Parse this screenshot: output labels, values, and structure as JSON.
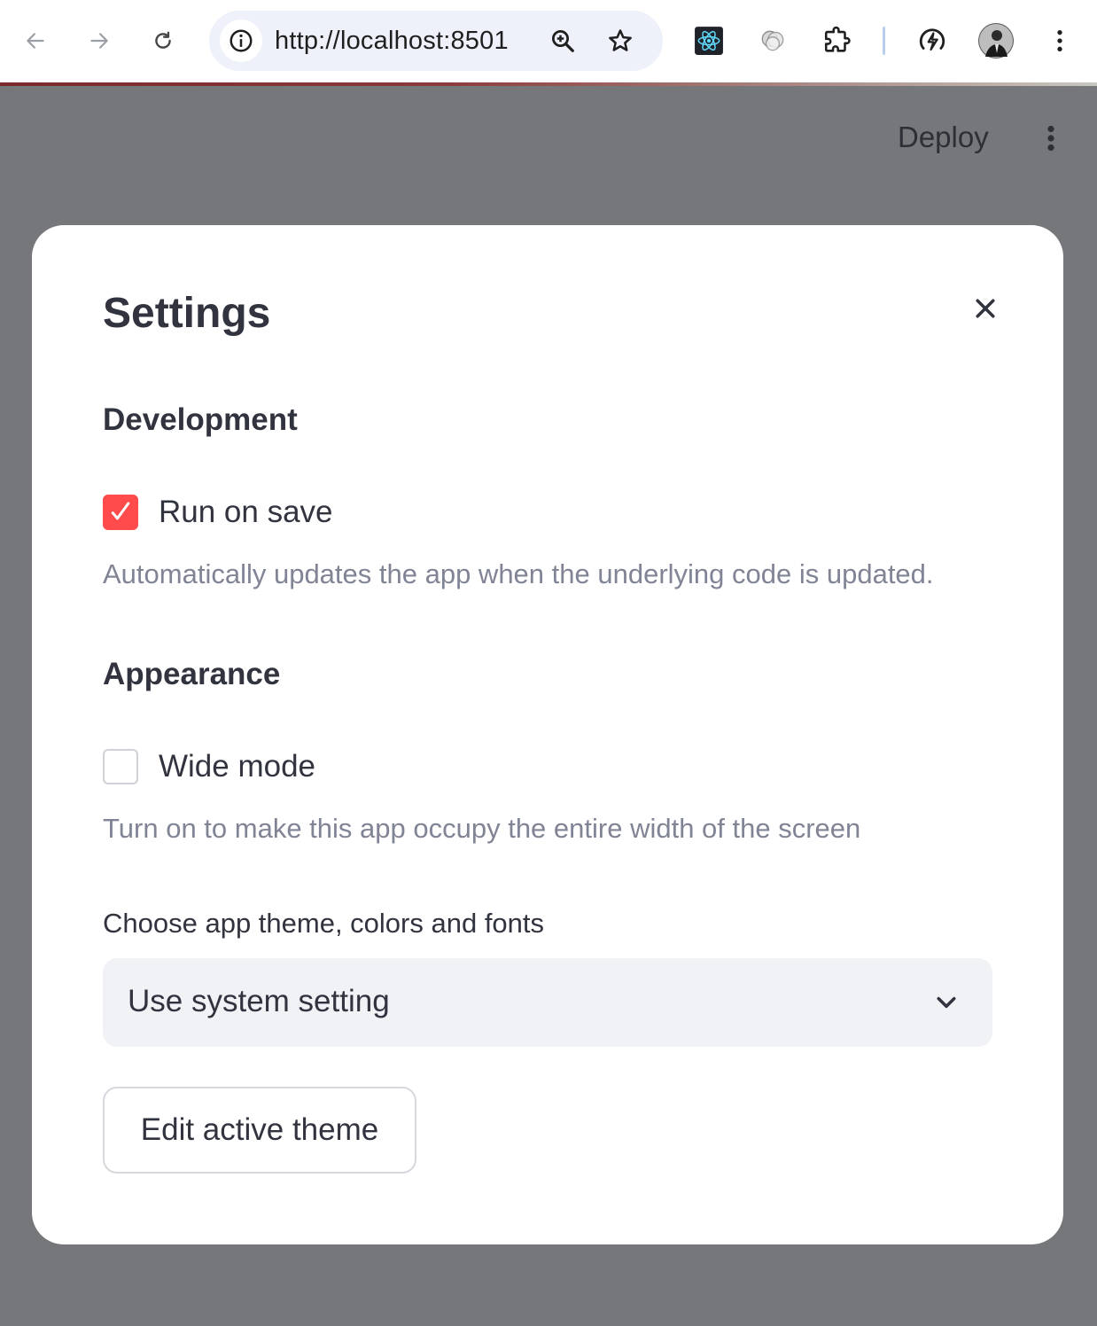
{
  "browser": {
    "url": "http://localhost:8501",
    "icons": [
      "back-arrow-icon",
      "forward-arrow-icon",
      "reload-icon",
      "site-info-icon",
      "zoom-icon",
      "bookmark-star-icon",
      "react-devtools-icon",
      "extension-icon",
      "puzzle-extensions-icon",
      "performance-icon",
      "profile-avatar",
      "more-vert-icon"
    ]
  },
  "app_header": {
    "deploy_label": "Deploy"
  },
  "settings_dialog": {
    "title": "Settings",
    "development": {
      "heading": "Development",
      "run_on_save": {
        "label": "Run on save",
        "checked": true,
        "help": "Automatically updates the app when the underlying code is updated."
      }
    },
    "appearance": {
      "heading": "Appearance",
      "wide_mode": {
        "label": "Wide mode",
        "checked": false,
        "help": "Turn on to make this app occupy the entire width of the screen"
      },
      "theme_label": "Choose app theme, colors and fonts",
      "theme_selected": "Use system setting",
      "edit_theme_button": "Edit active theme"
    }
  },
  "colors": {
    "accent": "#ff4b4b",
    "text": "#31333f",
    "muted_text": "#808495",
    "overlay": "#76777b"
  }
}
